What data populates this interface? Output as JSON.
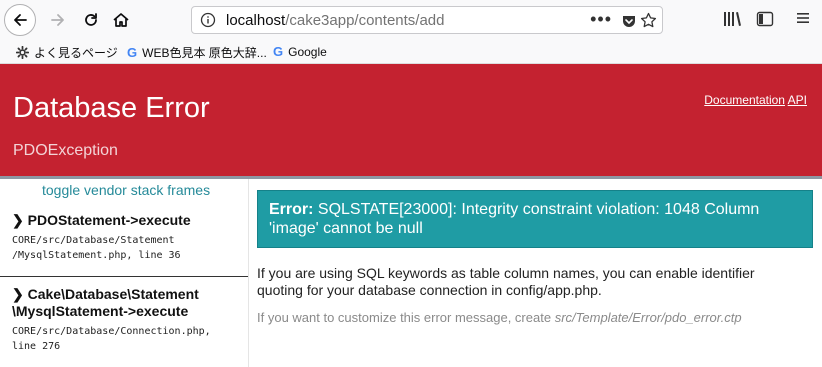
{
  "browser": {
    "url_host": "localhost",
    "url_path": "/cake3app/contents/add",
    "url_dots": "•••",
    "bookmarks": [
      {
        "icon": "gear-icon",
        "label": "よく見るページ"
      },
      {
        "icon": "google-icon",
        "label": "WEB色見本 原色大辞..."
      },
      {
        "icon": "google-icon",
        "label": "Google"
      }
    ],
    "google_glyph": "G"
  },
  "header": {
    "title": "Database Error",
    "subtitle": "PDOException",
    "link_documentation": "Documentation",
    "link_api": "API"
  },
  "sidebar": {
    "toggle_label": "toggle vendor stack frames",
    "frames": [
      {
        "title": "❯ PDOStatement->execute",
        "file_line1": "CORE/src/Database/Statement",
        "file_line2": "/MysqlStatement.php, line 36"
      },
      {
        "title_line1": "❯ Cake\\Database\\Statement",
        "title_line2": "\\MysqlStatement->execute",
        "file_line1": "CORE/src/Database/Connection.php,",
        "file_line2": "line 276"
      }
    ]
  },
  "main": {
    "error_label": "Error:",
    "error_message": "SQLSTATE[23000]: Integrity constraint violation: 1048 Column 'image' cannot be null",
    "message": "If you are using SQL keywords as table column names, you can enable identifier quoting for your database connection in config/app.php.",
    "customize_prefix": "If you want to customize this error message, create",
    "customize_path": "src/Template/Error/pdo_error.ctp"
  },
  "colors": {
    "header_bg": "#c42230",
    "error_box": "#1f9ca4",
    "toggle_link": "#258a99"
  }
}
